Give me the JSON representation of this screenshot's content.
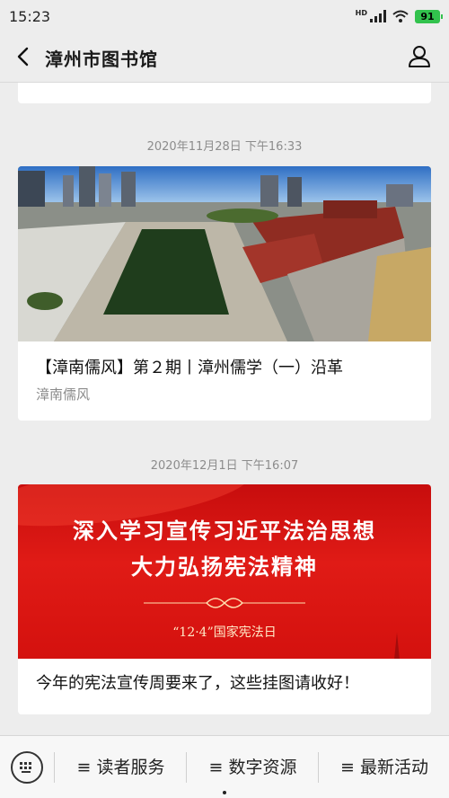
{
  "status": {
    "time": "15:23",
    "network": "HD",
    "battery": "91"
  },
  "nav": {
    "title": "漳州市图书馆"
  },
  "messages": [
    {
      "timestamp": "2020年11月28日 下午16:33",
      "title": "【漳南儒风】第２期丨漳州儒学（一）沿革",
      "source": "漳南儒风",
      "image": "aerial-photo-confucian-temple-with-pond"
    },
    {
      "timestamp": "2020年12月1日 下午16:07",
      "banner_line1": "深入学习宣传习近平法治思想",
      "banner_line2": "大力弘扬宪法精神",
      "banner_date": "“12·4”国家宪法日",
      "title": "今年的宪法宣传周要来了，这些挂图请收好！"
    }
  ],
  "menu": {
    "items": [
      "≡ 读者服务",
      "≡ 数字资源",
      "≡ 最新活动"
    ]
  },
  "colors": {
    "banner_red": "#d4110e",
    "battery_green": "#32c24d"
  }
}
